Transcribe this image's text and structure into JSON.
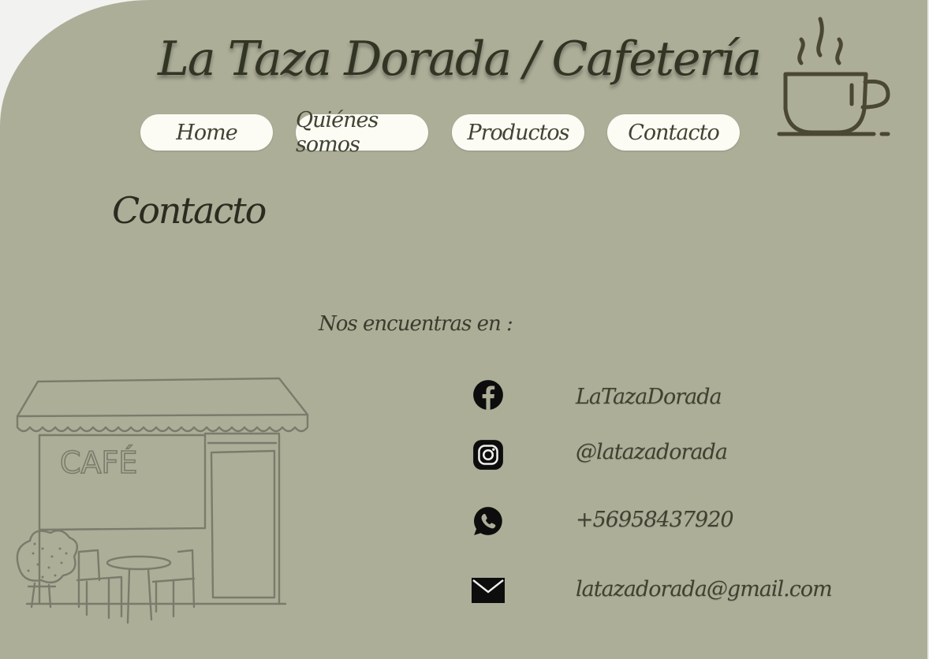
{
  "site": {
    "title": "La Taza Dorada / Cafetería",
    "logo_icon": "coffee-cup-icon",
    "colors": {
      "background": "#adae98",
      "button": "#fcfcf5",
      "text_dark": "#323524"
    }
  },
  "nav": {
    "items": [
      {
        "label": "Home"
      },
      {
        "label": "Quiénes somos"
      },
      {
        "label": "Productos"
      },
      {
        "label": "Contacto"
      }
    ]
  },
  "main": {
    "title": "Contacto",
    "find_us": "Nos encuentras en :",
    "illustration": {
      "icon": "cafe-storefront-illustration",
      "sign_text": "CAFÉ"
    },
    "contacts": [
      {
        "icon": "facebook-icon",
        "value": "LaTazaDorada"
      },
      {
        "icon": "instagram-icon",
        "value": "@latazadorada"
      },
      {
        "icon": "whatsapp-icon",
        "value": "+56958437920"
      },
      {
        "icon": "mail-icon",
        "value": "latazadorada@gmail.com"
      }
    ]
  }
}
